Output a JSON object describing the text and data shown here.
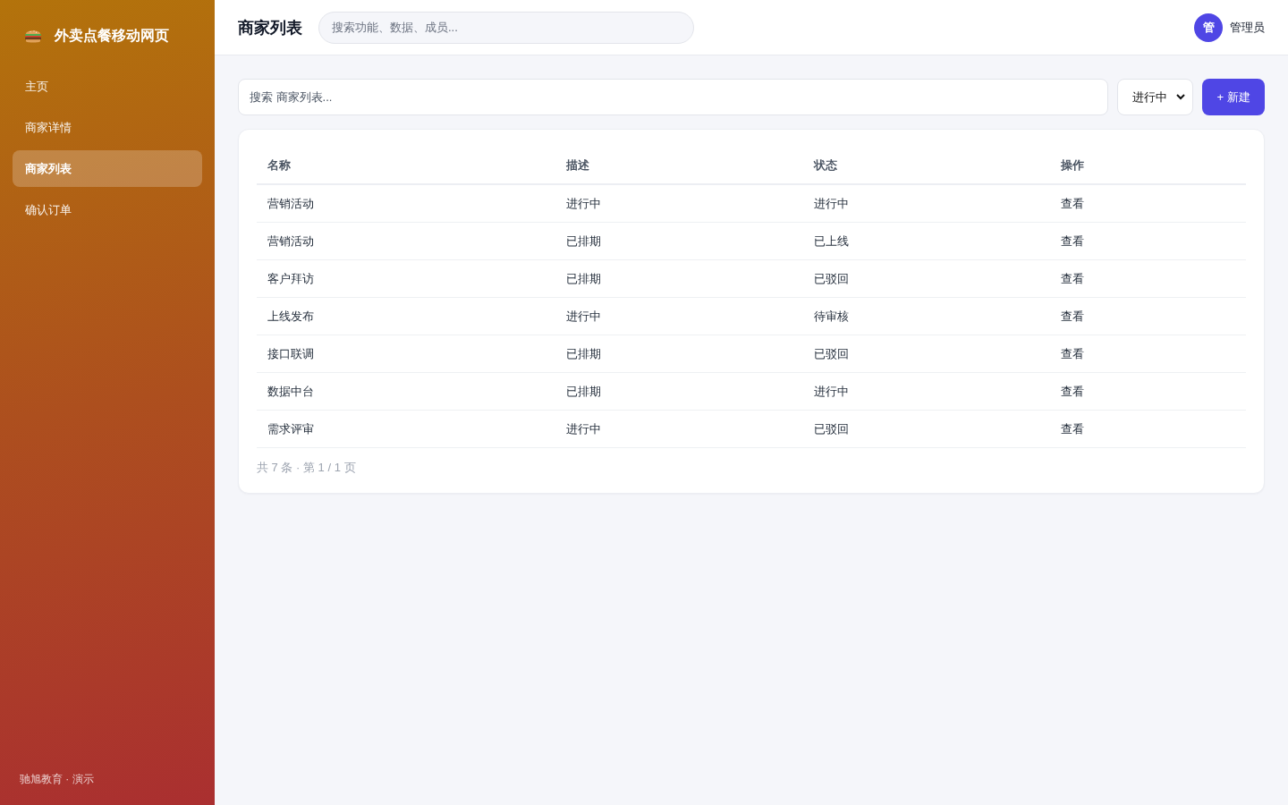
{
  "sidebar": {
    "brand": {
      "title": "外卖点餐移动网页"
    },
    "items": [
      {
        "label": "主页",
        "selected": false
      },
      {
        "label": "商家详情",
        "selected": false
      },
      {
        "label": "商家列表",
        "selected": true
      },
      {
        "label": "确认订单",
        "selected": false
      }
    ],
    "footer": "驰旭教育 · 演示"
  },
  "header": {
    "title": "商家列表",
    "search": {
      "placeholder": "搜索功能、数据、成员..."
    },
    "user": {
      "avatar": "管",
      "name": "管理员"
    }
  },
  "toolbar": {
    "search": {
      "placeholder": "搜索 商家列表..."
    },
    "filter": {
      "value": "进行中"
    },
    "new_button": "+ 新建"
  },
  "table": {
    "columns": [
      "名称",
      "描述",
      "状态",
      "操作"
    ],
    "rows": [
      [
        "营销活动",
        "进行中",
        "进行中",
        "查看"
      ],
      [
        "营销活动",
        "已排期",
        "已上线",
        "查看"
      ],
      [
        "客户拜访",
        "已排期",
        "已驳回",
        "查看"
      ],
      [
        "上线发布",
        "进行中",
        "待审核",
        "查看"
      ],
      [
        "接口联调",
        "已排期",
        "已驳回",
        "查看"
      ],
      [
        "数据中台",
        "已排期",
        "进行中",
        "查看"
      ],
      [
        "需求评审",
        "进行中",
        "已驳回",
        "查看"
      ]
    ],
    "pagination": "共 7 条 · 第 1 / 1 页"
  }
}
